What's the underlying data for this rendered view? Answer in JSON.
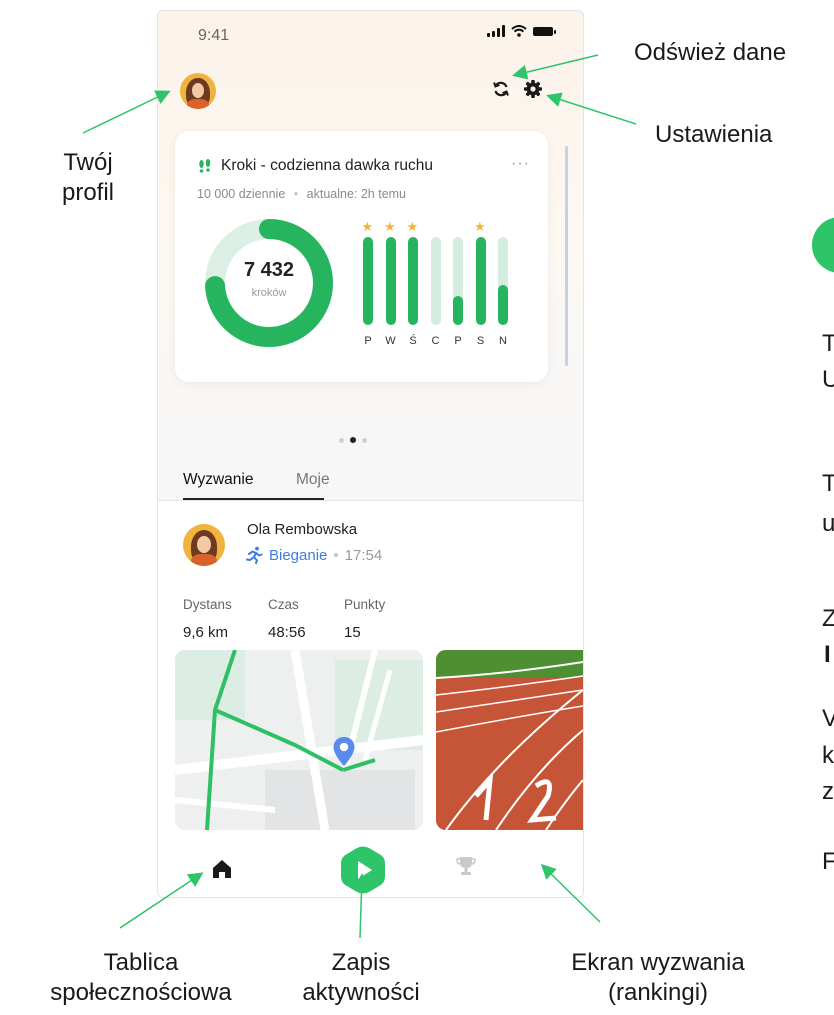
{
  "annotations": {
    "profile": "Twój profil",
    "refresh": "Odśwież dane",
    "settings": "Ustawienia",
    "board_line1": "Tablica",
    "board_line2": "społecznościowa",
    "record_line1": "Zapis",
    "record_line2": "aktywności",
    "challenge_line1": "Ekran wyzwania",
    "challenge_line2": "(rankingi)"
  },
  "right_partial_text": [
    "T",
    "U",
    "T",
    "u",
    "Z",
    "I",
    "V",
    "k",
    "z",
    "F"
  ],
  "status_bar": {
    "time": "9:41"
  },
  "icons": {
    "avatar": "avatar-photo",
    "refresh": "refresh-icon",
    "settings": "gear-icon",
    "steps": "footsteps-icon",
    "run": "running-icon",
    "location": "location-pin-icon",
    "home": "home-icon",
    "play": "play-icon",
    "trophy": "trophy-icon"
  },
  "steps_card": {
    "title": "Kroki - codzienna dawka ruchu",
    "menu": "···",
    "daily_goal": "10 000 dziennie",
    "separator": "•",
    "updated": "aktualne: 2h temu",
    "steps_value": "7 432",
    "steps_label": "kroków",
    "goal_progress": 0.74,
    "week": {
      "days": [
        "P",
        "W",
        "Ś",
        "C",
        "P",
        "S",
        "N"
      ],
      "progress": [
        1.0,
        1.0,
        1.0,
        0.0,
        0.33,
        1.0,
        0.45
      ],
      "goal_met": [
        true,
        true,
        true,
        false,
        false,
        true,
        false
      ]
    }
  },
  "pager": {
    "pages": 3,
    "active": 1
  },
  "tabs": [
    "Wyzwanie",
    "Moje"
  ],
  "post": {
    "user_name": "Ola Rembowska",
    "activity": "Bieganie",
    "dot": "•",
    "time": "17:54",
    "stats": [
      {
        "label": "Dystans",
        "value": "9,6 km"
      },
      {
        "label": "Czas",
        "value": "48:56"
      },
      {
        "label": "Punkty",
        "value": "15"
      }
    ]
  },
  "colors": {
    "accent_green": "#27b45e",
    "play_green": "#2ec46a",
    "activity_blue": "#3f7ce0",
    "star": "#f3b531",
    "arrow": "#2ec46a"
  }
}
